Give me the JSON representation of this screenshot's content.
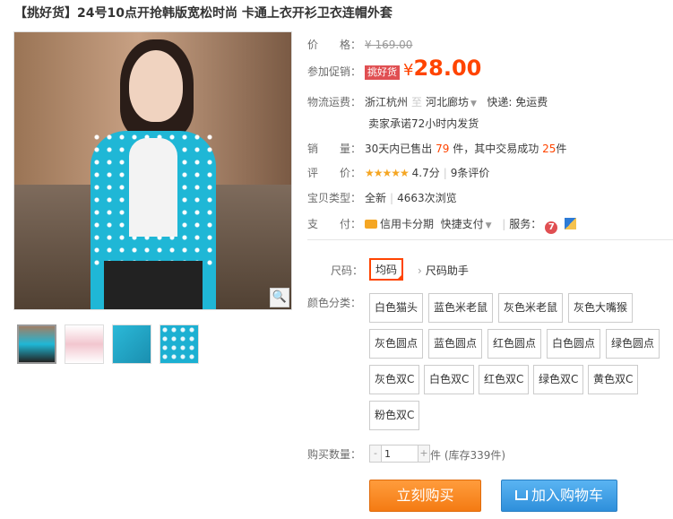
{
  "title": "【挑好货】24号10点开抢韩版宽松时尚 卡通上衣开衫卫衣连帽外套",
  "price": {
    "label": "价　　格：",
    "original": "¥ 169.00"
  },
  "promo": {
    "label": "参加促销：",
    "badge": "挑好货",
    "yen": "¥",
    "price": "28.00"
  },
  "shipping": {
    "label": "物流运费：",
    "from": "浙江杭州",
    "sep": "至",
    "to": "河北廊坊",
    "fee": "快递: 免运费",
    "promise": "卖家承诺72小时内发货"
  },
  "sales": {
    "label": "销　　量：",
    "prefix": "30天内已售出",
    "sold": "79",
    "mid": "件，其中交易成功",
    "success": "25",
    "suffix": "件"
  },
  "rating": {
    "label": "评　　价：",
    "stars": "★★★★★",
    "score": "4.7分",
    "sep": "|",
    "reviews": "9条评价"
  },
  "type": {
    "label": "宝贝类型：",
    "value": "全新",
    "sep": "|",
    "views": "4663次浏览"
  },
  "payment": {
    "label": "支　　付：",
    "credit": "信用卡分期",
    "quick": "快捷支付",
    "service_label": "服务：",
    "seven": "7"
  },
  "size": {
    "label": "尺码：",
    "selected": "均码",
    "help": "尺码助手"
  },
  "color": {
    "label": "颜色分类：",
    "options": [
      "白色猫头",
      "蓝色米老鼠",
      "灰色米老鼠",
      "灰色大嘴猴",
      "灰色圆点",
      "蓝色圆点",
      "红色圆点",
      "白色圆点",
      "绿色圆点",
      "灰色双C",
      "白色双C",
      "红色双C",
      "绿色双C",
      "黄色双C",
      "粉色双C"
    ]
  },
  "quantity": {
    "label": "购买数量：",
    "value": "1",
    "minus": "-",
    "plus": "+",
    "stock": "件 (库存339件)"
  },
  "actions": {
    "buy": "立刻购买",
    "cart": "加入购物车"
  },
  "icons": {
    "zoom": "zoom-icon",
    "credit": "credit-card-icon",
    "seven": "seven-day-return-icon",
    "shield": "guarantee-icon",
    "cart": "cart-icon"
  },
  "colors": {
    "accent": "#ff4400",
    "buy": "#f47b13",
    "cart": "#2e8fdb",
    "star": "#f5a623"
  }
}
